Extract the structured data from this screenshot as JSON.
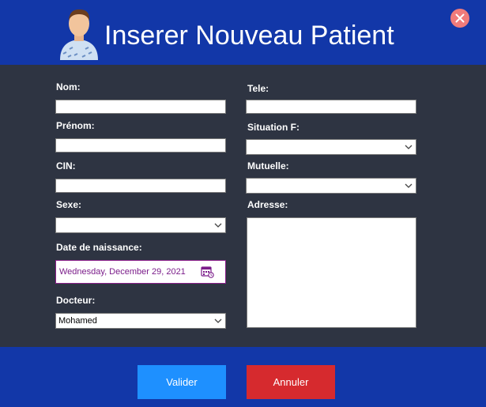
{
  "header": {
    "title": "Inserer Nouveau Patient",
    "avatar_icon": "patient-avatar-icon",
    "close_icon": "close-icon",
    "background": "#1237a8",
    "close_color": "#f07b7b"
  },
  "form": {
    "nom": {
      "label": "Nom:",
      "value": ""
    },
    "prenom": {
      "label": "Prénom:",
      "value": ""
    },
    "cin": {
      "label": "CIN:",
      "value": ""
    },
    "sexe": {
      "label": "Sexe:",
      "value": ""
    },
    "date_naissance": {
      "label": "Date de naissance:",
      "value": "Wednesday, December 29, 2021",
      "icon": "calendar-icon"
    },
    "docteur": {
      "label": "Docteur:",
      "value": "Mohamed"
    },
    "tele": {
      "label": "Tele:",
      "value": ""
    },
    "situation": {
      "label": "Situation F:",
      "value": ""
    },
    "mutuelle": {
      "label": "Mutuelle:",
      "value": ""
    },
    "adresse": {
      "label": "Adresse:",
      "value": ""
    }
  },
  "footer": {
    "valider_label": "Valider",
    "annuler_label": "Annuler",
    "valider_color": "#1e90ff",
    "annuler_color": "#d62a2e"
  }
}
